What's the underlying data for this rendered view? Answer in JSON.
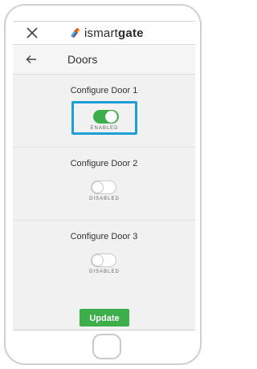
{
  "header": {
    "close_icon": "close-icon",
    "logo_icon": "ismartgate-logo-icon",
    "brand_prefix": "ismart",
    "brand_suffix": "gate"
  },
  "subheader": {
    "back_icon": "arrow-left-icon",
    "title": "Doors"
  },
  "doors": [
    {
      "title": "Configure Door 1",
      "state_label": "ENABLED",
      "enabled": true,
      "focused": true
    },
    {
      "title": "Configure Door 2",
      "state_label": "DISABLED",
      "enabled": false,
      "focused": false
    },
    {
      "title": "Configure Door 3",
      "state_label": "DISABLED",
      "enabled": false,
      "focused": false
    }
  ],
  "actions": {
    "update_label": "Update"
  },
  "colors": {
    "accent_green": "#3cae4a",
    "focus_blue": "#1e9ed8"
  }
}
